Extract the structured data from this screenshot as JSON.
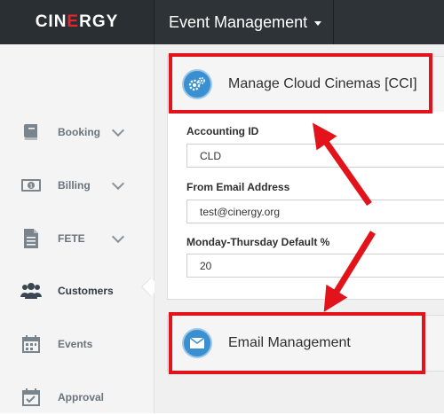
{
  "app": {
    "logo_left": "CIN",
    "logo_e": "E",
    "logo_right": "RGY",
    "nav_title": "Event Management"
  },
  "sidebar": {
    "items": [
      {
        "label": "Booking",
        "icon": "book-icon",
        "expandable": true
      },
      {
        "label": "Billing",
        "icon": "money-icon",
        "expandable": true
      },
      {
        "label": "FETE",
        "icon": "document-icon",
        "expandable": true
      },
      {
        "label": "Customers",
        "icon": "users-icon",
        "expandable": false,
        "active": true
      },
      {
        "label": "Events",
        "icon": "calendar-icon",
        "expandable": false
      },
      {
        "label": "Approval",
        "icon": "calendar-check-icon",
        "expandable": false
      }
    ]
  },
  "panels": {
    "cloud": {
      "title": "Manage Cloud Cinemas [CCI]",
      "icon": "gears-icon"
    },
    "email": {
      "title": "Email Management",
      "icon": "envelope-icon"
    }
  },
  "form": {
    "accounting_id": {
      "label": "Accounting ID",
      "value": "CLD"
    },
    "from_email": {
      "label": "From Email Address",
      "value": "test@cinergy.org"
    },
    "mon_thu_default": {
      "label": "Monday-Thursday Default %",
      "value": "20"
    }
  },
  "colors": {
    "topbar": "#2e3338",
    "logo_accent": "#e0282e",
    "highlight": "#e3131b",
    "icon_blue": "#3a8fd1"
  }
}
